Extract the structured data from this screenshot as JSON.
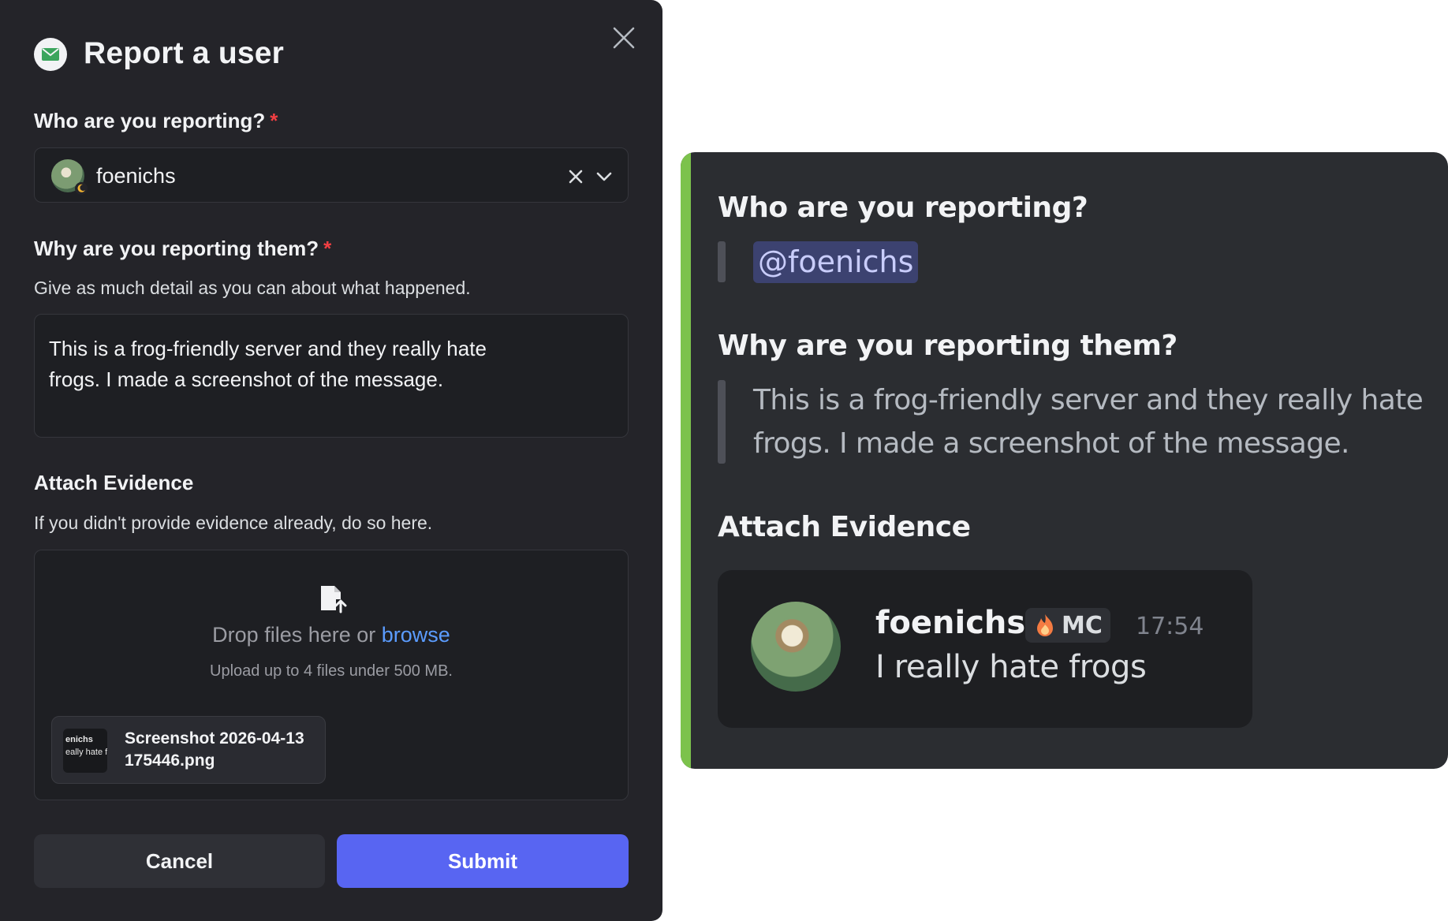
{
  "modal": {
    "title": "Report a user",
    "icon": "mail-icon",
    "close_icon": "close-icon",
    "who_label": "Who are you reporting?",
    "required_mark": "*",
    "selected_user": "foenichs",
    "why_label": "Why are you reporting them?",
    "why_hint": "Give as much detail as you can about what happened.",
    "why_value": "This is a frog-friendly server and they really hate frogs. I made a screenshot of the message.",
    "evidence_label": "Attach Evidence",
    "evidence_hint": "If you didn't provide evidence already, do so here.",
    "drop_text": "Drop files here or",
    "browse_label": "browse",
    "upload_limit": "Upload up to 4 files under 500 MB.",
    "file": {
      "name": "Screenshot 2026-04-13 175446.png",
      "thumb_line1": "enichs",
      "thumb_line2": "eally hate f"
    },
    "cancel_label": "Cancel",
    "submit_label": "Submit"
  },
  "embed": {
    "who_heading": "Who are you reporting?",
    "mention": "@foenichs",
    "why_heading": "Why are you reporting them?",
    "why_text": "This is a frog-friendly server and they really hate frogs. I made a screenshot of the message.",
    "evidence_heading": "Attach Evidence",
    "message": {
      "author": "foenichs",
      "role_tag": "MC",
      "time": "17:54",
      "text": "I really hate frogs"
    },
    "accent_color": "#7cc24c"
  },
  "colors": {
    "modal_bg": "#242429",
    "submit": "#5865f2",
    "link": "#5b9cff",
    "required": "#f23f43"
  }
}
